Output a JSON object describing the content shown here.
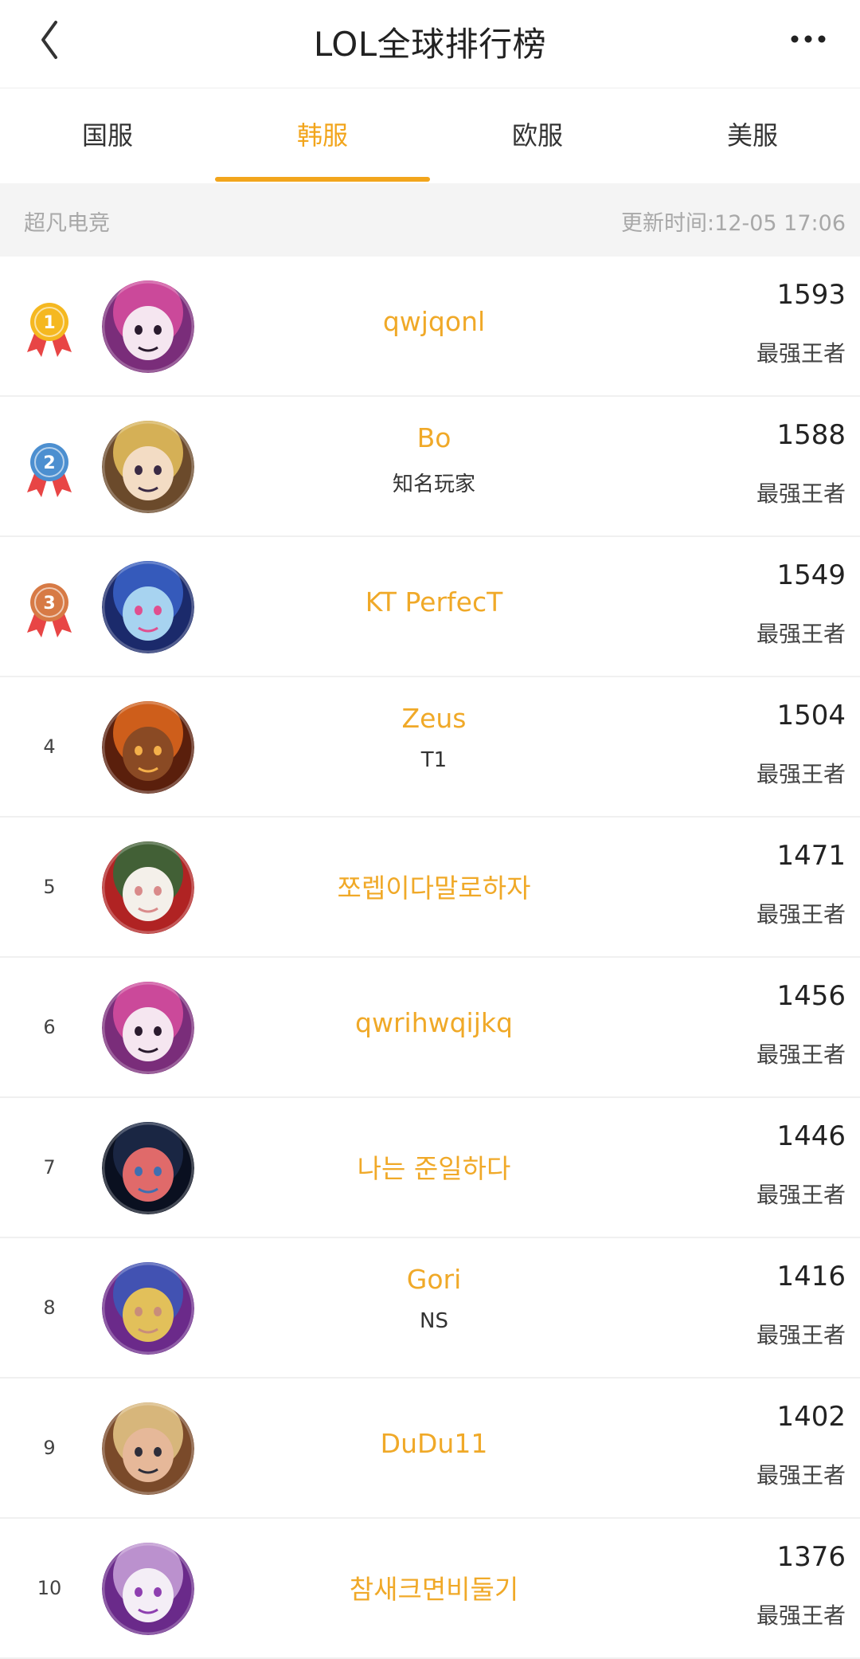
{
  "header": {
    "title": "LOL全球排行榜",
    "back_icon": "chevron-left-icon",
    "more_icon": "more-horizontal-icon"
  },
  "tabs": [
    {
      "label": "国服",
      "active": false
    },
    {
      "label": "韩服",
      "active": true
    },
    {
      "label": "欧服",
      "active": false
    },
    {
      "label": "美服",
      "active": false
    }
  ],
  "info": {
    "source": "超凡电竞",
    "updated": "更新时间:12-05 17:06"
  },
  "colors": {
    "accent": "#f2a51c",
    "name": "#f0a928",
    "gold": "#f5b820",
    "silver": "#4c8fd0",
    "bronze": "#d77a45",
    "ribbon": "#e84545"
  },
  "players": [
    {
      "rank": "1",
      "medal": "gold",
      "name": "qwjqonl",
      "team": "",
      "score": "1593",
      "tier": "最强王者",
      "avatar": "pink-panda-avatar"
    },
    {
      "rank": "2",
      "medal": "silver",
      "name": "Bo",
      "team": "知名玩家",
      "score": "1588",
      "tier": "最强王者",
      "avatar": "blonde-mage-avatar"
    },
    {
      "rank": "3",
      "medal": "bronze",
      "name": "KT PerfecT",
      "team": "",
      "score": "1549",
      "tier": "最强王者",
      "avatar": "blue-poro-avatar"
    },
    {
      "rank": "4",
      "medal": "",
      "name": "Zeus",
      "team": "T1",
      "score": "1504",
      "tier": "最强王者",
      "avatar": "tibbers-avatar"
    },
    {
      "rank": "5",
      "medal": "",
      "name": "쪼렙이다말로하자",
      "team": "",
      "score": "1471",
      "tier": "最强王者",
      "avatar": "white-poro-avatar"
    },
    {
      "rank": "6",
      "medal": "",
      "name": "qwrihwqijkq",
      "team": "",
      "score": "1456",
      "tier": "最强王者",
      "avatar": "pink-panda-avatar"
    },
    {
      "rank": "7",
      "medal": "",
      "name": "나는 준일하다",
      "team": "",
      "score": "1446",
      "tier": "最强王者",
      "avatar": "dark-creature-avatar"
    },
    {
      "rank": "8",
      "medal": "",
      "name": "Gori",
      "team": "NS",
      "score": "1416",
      "tier": "最强王者",
      "avatar": "armored-warrior-avatar"
    },
    {
      "rank": "9",
      "medal": "",
      "name": "DuDu11",
      "team": "",
      "score": "1402",
      "tier": "最强王者",
      "avatar": "blonde-heroine-avatar"
    },
    {
      "rank": "10",
      "medal": "",
      "name": "참새크면비둘기",
      "team": "",
      "score": "1376",
      "tier": "最强王者",
      "avatar": "purple-poro-avatar"
    }
  ]
}
